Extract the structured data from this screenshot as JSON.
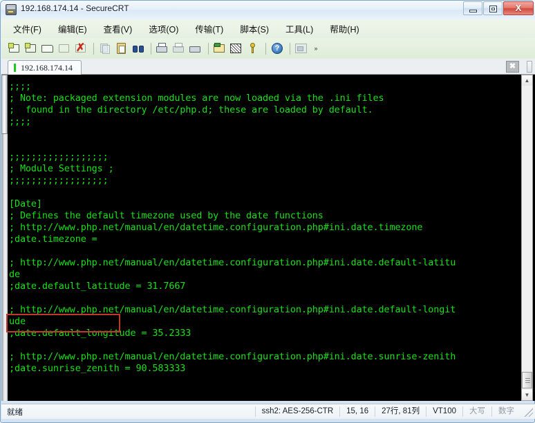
{
  "window": {
    "title": "192.168.174.14 - SecureCRT",
    "icon": "securecrt-app-icon",
    "controls": {
      "minimize": "–",
      "maximize": "❐",
      "close": "X"
    }
  },
  "menubar": {
    "items": [
      {
        "label": "文件(F)",
        "name": "menu-file"
      },
      {
        "label": "编辑(E)",
        "name": "menu-edit"
      },
      {
        "label": "查看(V)",
        "name": "menu-view"
      },
      {
        "label": "选项(O)",
        "name": "menu-options"
      },
      {
        "label": "传输(T)",
        "name": "menu-transfer"
      },
      {
        "label": "脚本(S)",
        "name": "menu-script"
      },
      {
        "label": "工具(L)",
        "name": "menu-tools"
      },
      {
        "label": "帮助(H)",
        "name": "menu-help"
      }
    ]
  },
  "toolbar": {
    "overflow_label": "»",
    "buttons": [
      "new-session-icon",
      "connect-sftp-icon",
      "connect-folder-icon",
      "reconnect-icon",
      "disconnect-icon",
      "copy-icon",
      "paste-icon",
      "find-icon",
      "print-icon",
      "print-selection-icon",
      "printer-icon",
      "session-options-icon",
      "log-session-icon",
      "key-icon",
      "help-icon",
      "arrange-windows-icon"
    ]
  },
  "tabs": {
    "active_tab": "192.168.174.14",
    "close_label": "✖"
  },
  "terminal": {
    "fg_color": "#19e019",
    "bg_color": "#000000",
    "lines": [
      ";;;;",
      "; Note: packaged extension modules are now loaded via the .ini files",
      ";  found in the directory /etc/php.d; these are loaded by default.",
      ";;;;",
      "",
      "",
      ";;;;;;;;;;;;;;;;;;",
      "; Module Settings ;",
      ";;;;;;;;;;;;;;;;;;",
      "",
      "[Date]",
      "; Defines the default timezone used by the date functions",
      "; http://www.php.net/manual/en/datetime.configuration.php#ini.date.timezone",
      ";date.timezone =",
      "",
      "; http://www.php.net/manual/en/datetime.configuration.php#ini.date.default-latitu",
      "de",
      ";date.default_latitude = 31.7667",
      "",
      "; http://www.php.net/manual/en/datetime.configuration.php#ini.date.default-longit",
      "ude",
      ";date.default_longitude = 35.2333",
      "",
      "; http://www.php.net/manual/en/datetime.configuration.php#ini.date.sunrise-zenith",
      ";date.sunrise_zenith = 90.583333"
    ],
    "highlight": {
      "text": ";date.timezone =",
      "color": "#c0392b"
    }
  },
  "statusbar": {
    "ready": "就绪",
    "cipher": "ssh2: AES-256-CTR",
    "cursor": "15, 16",
    "size": "27行, 81列",
    "emulation": "VT100",
    "caps": "大写",
    "num": "数字"
  }
}
